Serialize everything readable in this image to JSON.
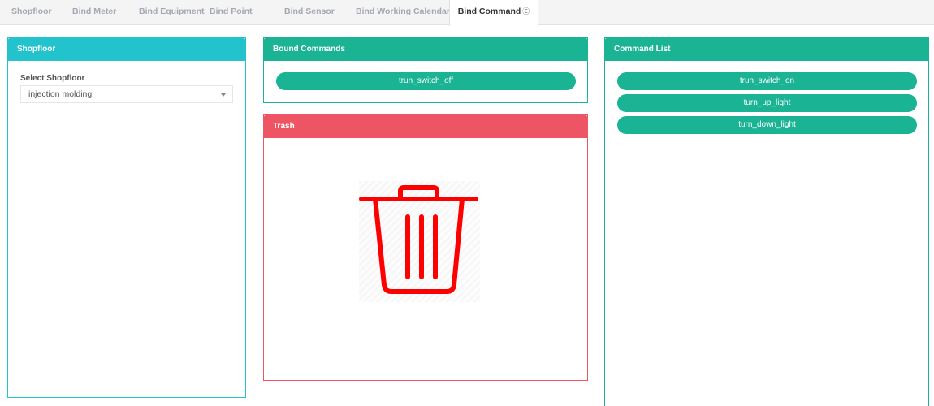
{
  "tabs": [
    {
      "label": "Shopfloor"
    },
    {
      "label": "Bind Meter"
    },
    {
      "label": "Bind Equipment"
    },
    {
      "label": "Bind Point"
    },
    {
      "label": "Bind Sensor"
    },
    {
      "label": "Bind Working Calendar"
    },
    {
      "label": "Bind Command",
      "active": true,
      "badge": "E"
    }
  ],
  "shopfloor_panel": {
    "title": "Shopfloor",
    "select_label": "Select Shopfloor",
    "selected": "injection molding"
  },
  "bound_panel": {
    "title": "Bound Commands",
    "items": [
      "trun_switch_off"
    ]
  },
  "trash_panel": {
    "title": "Trash",
    "icon": "trash-icon"
  },
  "command_list_panel": {
    "title": "Command List",
    "items": [
      "trun_switch_on",
      "turn_up_light",
      "turn_down_light"
    ]
  },
  "colors": {
    "cyan": "#22c3cc",
    "green": "#1ab394",
    "red": "#ed5565",
    "trash_icon": "#ff0000"
  }
}
